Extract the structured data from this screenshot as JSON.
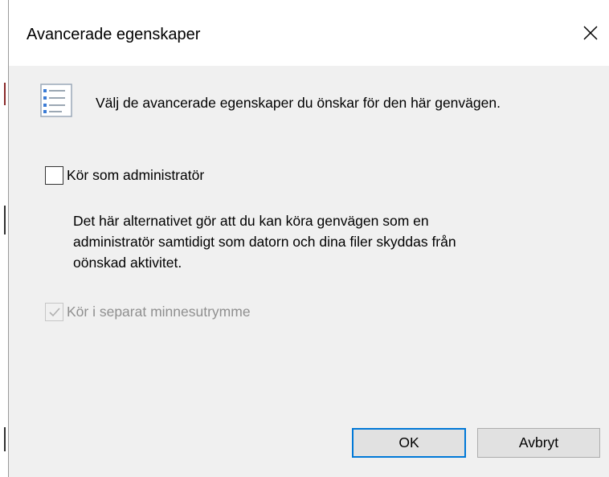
{
  "window": {
    "title": "Avancerade egenskaper",
    "close_symbol": "✕"
  },
  "header": {
    "icon": "properties-list-icon",
    "text": "Välj de avancerade egenskaper du önskar för den här genvägen."
  },
  "options": {
    "run_as_admin": {
      "label": "Kör som administratör",
      "checked": false,
      "enabled": true
    },
    "description_lines": [
      "Det här alternativet gör att du kan köra genvägen som en",
      "administratör samtidigt som datorn och dina filer skyddas från",
      "oönskad aktivitet."
    ],
    "separate_memory": {
      "label": "Kör i separat minnesutrymme",
      "checked": true,
      "enabled": false
    }
  },
  "buttons": {
    "ok_label": "OK",
    "cancel_label": "Avbryt"
  },
  "colors": {
    "dialog_bg": "#f0f0f0",
    "titlebar_bg": "#ffffff",
    "focus_border": "#0078d7",
    "disabled_text": "#8f8f8f",
    "button_bg": "#e1e1e1"
  }
}
